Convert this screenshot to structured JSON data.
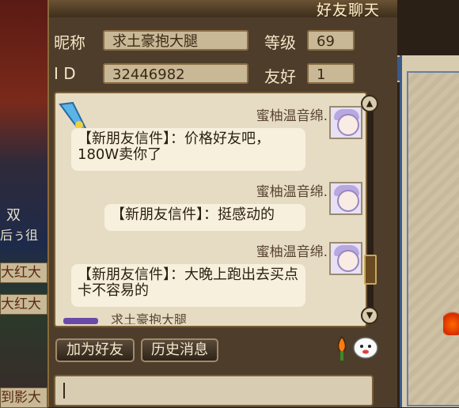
{
  "window": {
    "title": "好友聊天"
  },
  "profile": {
    "nickname_label": "昵称",
    "nickname": "求土豪抱大腿",
    "level_label": "等级",
    "level": "69",
    "id_label": "I D",
    "id": "32446982",
    "friendship_label": "友好",
    "friendship": "1"
  },
  "messages": [
    {
      "sender": "蜜柚温音绵.",
      "text": "【新朋友信件】：价格好友吧，180W卖你了"
    },
    {
      "sender": "蜜柚温音绵.",
      "text": "【新朋友信件】：挺感动的"
    },
    {
      "sender": "蜜柚温音绵.",
      "text": "【新朋友信件】：大晚上跑出去买点卡不容易的"
    }
  ],
  "partial_next_sender": "求土豪抱大腿",
  "buttons": {
    "add_friend": "加为好友",
    "history": "历史消息"
  },
  "background_left": {
    "labels": [
      "大红大",
      "大红大",
      "到影大"
    ],
    "chars": [
      "双",
      "后ぅ徂"
    ]
  },
  "colors": {
    "panel": "#4e3d2a",
    "chat_bg": "#e6dcc4",
    "bubble": "#f7f0dc",
    "accent_blue": "#3a5a8a"
  },
  "icons": [
    "gem-pen-icon",
    "fire-torch-icon",
    "ghost-emoji-icon",
    "scroll-up-icon",
    "scroll-down-icon"
  ]
}
